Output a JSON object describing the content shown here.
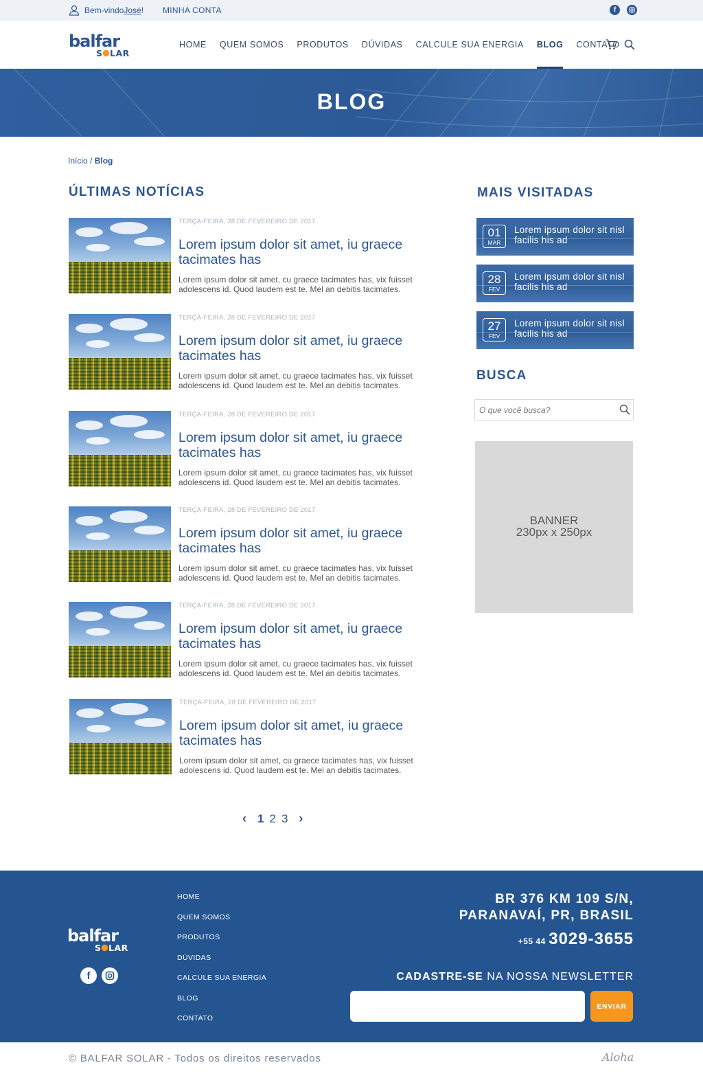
{
  "topbar": {
    "welcome_prefix": "Bem-vindo ",
    "user_name": "José",
    "welcome_suffix": "!",
    "account": "MINHA CONTA"
  },
  "brand": {
    "logo_top": "balfar",
    "logo_bottom": "SOLAR"
  },
  "nav": {
    "home": "HOME",
    "about": "QUEM SOMOS",
    "products": "PRODUTOS",
    "faq": "DÚVIDAS",
    "calc": "CALCULE SUA ENERGIA",
    "blog": "BLOG",
    "contact": "CONTATO"
  },
  "hero": {
    "title": "BLOG"
  },
  "breadcrumb": {
    "home": "Início",
    "sep": " / ",
    "current": "Blog"
  },
  "latest": {
    "heading": "ÚLTIMAS NOTÍCIAS",
    "items": [
      {
        "date": "TERÇA-FEIRA, 28 DE FEVEREIRO DE 2017",
        "title": "Lorem ipsum dolor sit amet, iu graece tacimates has",
        "excerpt": "Lorem ipsum dolor sit amet, cu graece tacimates has, vix fuisset adolescens id. Quod laudem est te. Mel an debitis tacimates."
      },
      {
        "date": "TERÇA-FEIRA, 28 DE FEVEREIRO DE 2017",
        "title": "Lorem ipsum dolor sit amet, iu graece tacimates has",
        "excerpt": "Lorem ipsum dolor sit amet, cu graece tacimates has, vix fuisset adolescens id. Quod laudem est te. Mel an debitis tacimates."
      },
      {
        "date": "TERÇA-FEIRA, 28 DE FEVEREIRO DE 2017",
        "title": "Lorem ipsum dolor sit amet, iu graece tacimates has",
        "excerpt": "Lorem ipsum dolor sit amet, cu graece tacimates has, vix fuisset adolescens id. Quod laudem est te. Mel an debitis tacimates."
      },
      {
        "date": "TERÇA-FEIRA, 28 DE FEVEREIRO DE 2017",
        "title": "Lorem ipsum dolor sit amet, iu graece tacimates has",
        "excerpt": "Lorem ipsum dolor sit amet, cu graece tacimates has, vix fuisset adolescens id. Quod laudem est te. Mel an debitis tacimates."
      },
      {
        "date": "TERÇA-FEIRA, 28 DE FEVEREIRO DE 2017",
        "title": "Lorem ipsum dolor sit amet, iu graece tacimates has",
        "excerpt": "Lorem ipsum dolor sit amet, cu graece tacimates has, vix fuisset adolescens id. Quod laudem est te. Mel an debitis tacimates."
      },
      {
        "date": "TERÇA-FEIRA, 28 DE FEVEREIRO DE 2017",
        "title": "Lorem ipsum dolor sit amet, iu graece tacimates has",
        "excerpt": "Lorem ipsum dolor sit amet, cu graece tacimates has, vix fuisset adolescens id. Quod laudem est te. Mel an debitis tacimates."
      }
    ]
  },
  "sidebar": {
    "most_visited_heading": "MAIS VISITADAS",
    "most_visited": [
      {
        "day": "01",
        "month": "MAR",
        "text": "Lorem ipsum dolor sit nisl facilis his ad"
      },
      {
        "day": "28",
        "month": "FEV",
        "text": "Lorem ipsum dolor sit nisl facilis his ad"
      },
      {
        "day": "27",
        "month": "FEV",
        "text": "Lorem ipsum dolor sit nisl facilis his ad"
      }
    ],
    "search_heading": "BUSCA",
    "search_placeholder": "O que você busca?",
    "banner_line1": "BANNER",
    "banner_line2": "230px x 250px"
  },
  "pagination": {
    "prev": "‹",
    "pages": [
      "1",
      "2",
      "3"
    ],
    "next": "›",
    "current": "1"
  },
  "footer": {
    "links": [
      "HOME",
      "QUEM SOMOS",
      "PRODUTOS",
      "DÚVIDAS",
      "CALCULE SUA ENERGIA",
      "BLOG",
      "CONTATO"
    ],
    "address_line1": "BR 376 KM 109 S/N,",
    "address_line2": "PARANAVAÍ, PR,  BRASIL",
    "phone_prefix": "+55 44",
    "phone_number": "3029-3655",
    "newsletter_bold": "CADASTRE-SE",
    "newsletter_rest": " NA NOSSA NEWSLETTER",
    "send_label": "ENVIAR",
    "copyright": "© BALFAR SOLAR - Todos os direitos reservados",
    "credit": "Aloha"
  },
  "colors": {
    "brand_blue": "#2d5691",
    "footer_blue": "#255591",
    "accent_orange": "#f7961d"
  }
}
